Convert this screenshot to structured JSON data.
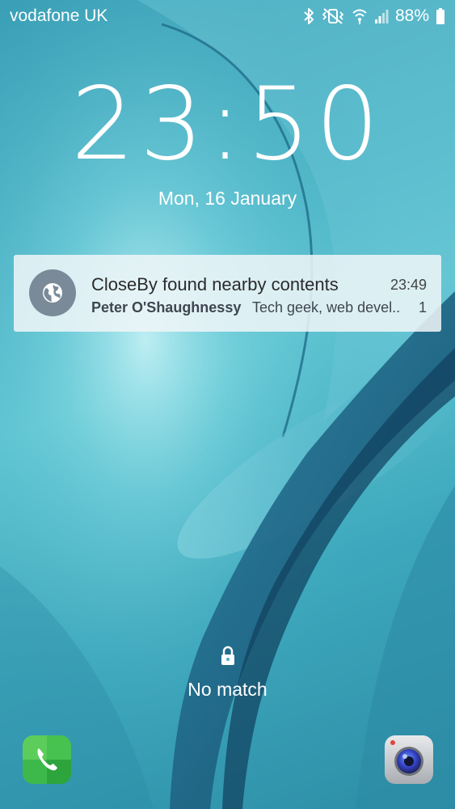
{
  "status_bar": {
    "carrier": "vodafone UK",
    "battery_percent": "88%",
    "icons": [
      "bluetooth-icon",
      "vibrate-mute-icon",
      "wifi-icon",
      "signal-icon",
      "battery-icon"
    ]
  },
  "lockscreen": {
    "time": "23:50",
    "date": "Mon, 16 January"
  },
  "notification": {
    "app_icon": "globe-icon",
    "title": "CloseBy found nearby contents",
    "time": "23:49",
    "sender": "Peter O'Shaughnessy",
    "text": "Tech geek, web devel..",
    "count": "1"
  },
  "lock": {
    "icon": "padlock-icon",
    "status": "No match"
  },
  "shortcuts": {
    "left": "phone-icon",
    "right": "camera-icon"
  },
  "colors": {
    "wallpaper_primary": "#4fb7c9",
    "wallpaper_dark": "#1d5d7a",
    "notification_bg": "#f0f6f8",
    "notification_icon_bg": "#7a8a99",
    "phone_green": "#3cb94a",
    "camera_gray": "#c9ccd0"
  }
}
